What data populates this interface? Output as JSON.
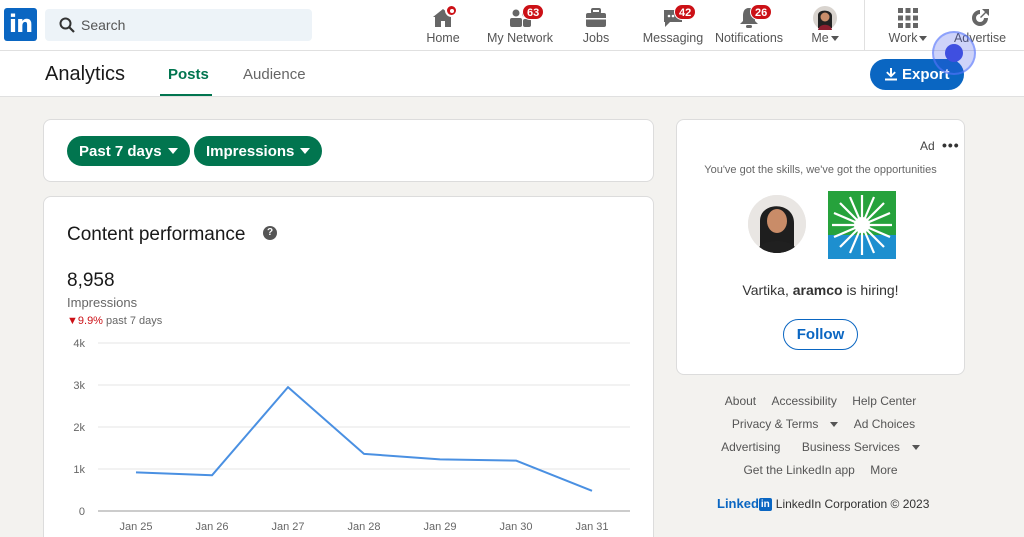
{
  "nav": {
    "logo_text": "in",
    "search_placeholder": "Search",
    "items": [
      {
        "label": "Home",
        "badge": ""
      },
      {
        "label": "My Network",
        "badge": "63"
      },
      {
        "label": "Jobs",
        "badge": ""
      },
      {
        "label": "Messaging",
        "badge": "42"
      },
      {
        "label": "Notifications",
        "badge": "26"
      },
      {
        "label": "Me",
        "badge": ""
      },
      {
        "label": "Work",
        "badge": ""
      },
      {
        "label": "Advertise",
        "badge": ""
      }
    ]
  },
  "subheader": {
    "title": "Analytics",
    "tabs": [
      {
        "label": "Posts",
        "active": true
      },
      {
        "label": "Audience",
        "active": false
      }
    ],
    "export_label": "Export"
  },
  "filters": {
    "range": "Past 7 days",
    "metric": "Impressions"
  },
  "performance": {
    "title": "Content performance",
    "help": "?",
    "value": "8,958",
    "label": "Impressions",
    "change": "9.9%",
    "change_period": "past 7 days"
  },
  "chart_data": {
    "type": "line",
    "categories": [
      "Jan 25",
      "Jan 26",
      "Jan 27",
      "Jan 28",
      "Jan 29",
      "Jan 30",
      "Jan 31"
    ],
    "series": [
      {
        "values": [
          920,
          850,
          2950,
          1360,
          1230,
          1200,
          480
        ]
      }
    ],
    "yticks": [
      "0",
      "1k",
      "2k",
      "3k",
      "4k"
    ],
    "ylim": [
      0,
      4000
    ],
    "grid": true,
    "line_color": "#4a90e2"
  },
  "ad": {
    "label": "Ad",
    "more": "•••",
    "tagline": "You've got the skills, we've got the opportunities",
    "hiring_name": "Vartika, ",
    "hiring_company": "aramco",
    "hiring_suffix": " is hiring!",
    "follow_label": "Follow"
  },
  "footer": {
    "row1": [
      "About",
      "Accessibility",
      "Help Center"
    ],
    "row2": [
      "Privacy & Terms",
      "Ad Choices"
    ],
    "row3": [
      "Advertising",
      "Business Services"
    ],
    "row4": [
      "Get the LinkedIn app",
      "More"
    ],
    "brand_word": "Linked",
    "brand_in": "in",
    "copyright": "LinkedIn Corporation © 2023"
  }
}
